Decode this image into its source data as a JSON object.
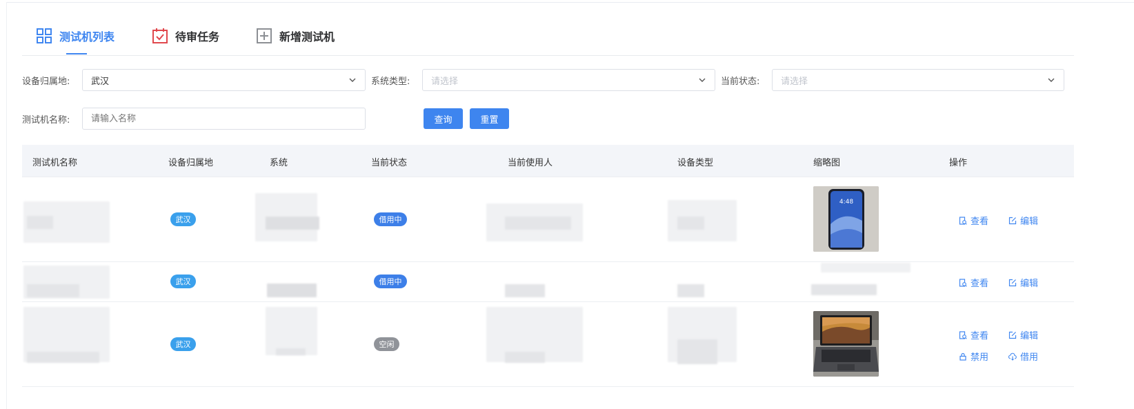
{
  "tabs": [
    {
      "label": "测试机列表",
      "icon": "grid-icon"
    },
    {
      "label": "待审任务",
      "icon": "calendar-check-icon"
    },
    {
      "label": "新增测试机",
      "icon": "plus-square-icon"
    }
  ],
  "filters": {
    "location_label": "设备归属地:",
    "location_value": "武汉",
    "system_label": "系统类型:",
    "system_placeholder": "请选择",
    "status_label": "当前状态:",
    "status_placeholder": "请选择",
    "name_label": "测试机名称:",
    "name_placeholder": "请输入名称",
    "query_button": "查询",
    "reset_button": "重置"
  },
  "table": {
    "columns": [
      "测试机名称",
      "设备归属地",
      "系统",
      "当前状态",
      "当前使用人",
      "设备类型",
      "缩略图",
      "操作"
    ],
    "rows": [
      {
        "location": "武汉",
        "status": "借用中",
        "actions": [
          "查看",
          "编辑"
        ]
      },
      {
        "location": "武汉",
        "status": "借用中",
        "actions": [
          "查看",
          "编辑"
        ]
      },
      {
        "location": "武汉",
        "status": "空闲",
        "actions": [
          "查看",
          "编辑",
          "禁用",
          "借用"
        ]
      }
    ]
  },
  "thumbnail_phone_time": "4:48",
  "colors": {
    "accent": "#3f86f0",
    "tag_location": "#3aa0ec",
    "tag_busy": "#3d7fe8",
    "tag_idle": "#909399",
    "header_bg": "#f3f5f9"
  }
}
